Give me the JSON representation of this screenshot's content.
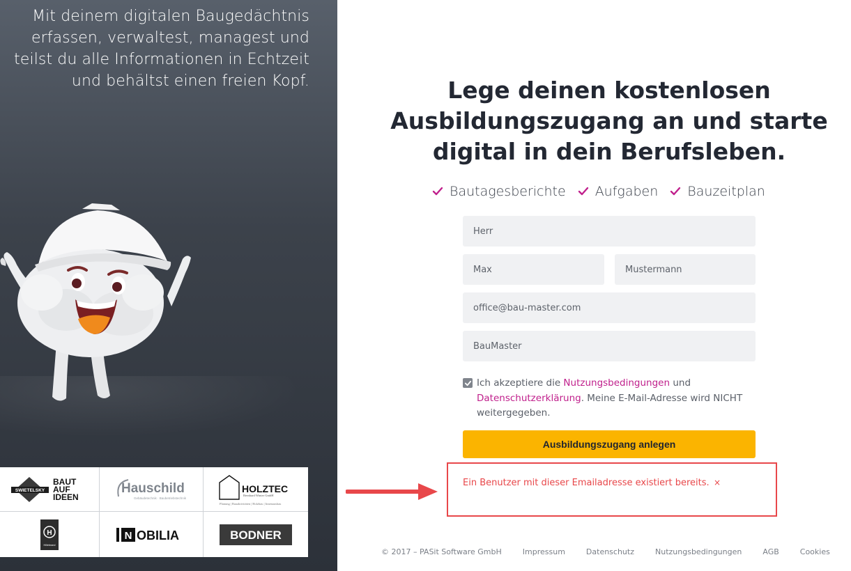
{
  "left": {
    "tagline": "Mit deinem digitalen Baugedächtnis erfassen, verwaltest, managest und teilst du alle Informationen in Echtzeit und behältst einen freien Kopf.",
    "logos": [
      {
        "name": "swietelsky-baut-auf-ideen",
        "text": "SWIETELSKY",
        "sub": "BAUT AUF IDEEN"
      },
      {
        "name": "hauschild",
        "text": "Hauschild",
        "sub": "Gebäudetechnik · Baubetriebstechnik"
      },
      {
        "name": "holztec",
        "text": "HOLZTEC",
        "sub": "Bernhard Winter GmbH"
      },
      {
        "name": "hillebrand",
        "text": "H",
        "sub": "Hillebrand"
      },
      {
        "name": "inmobilia",
        "text": "INMOBILIA"
      },
      {
        "name": "bodner",
        "text": "BODNER"
      }
    ]
  },
  "main": {
    "headline": "Lege deinen kostenlosen Ausbildungszugang an und starte digital in dein Berufsleben.",
    "features": [
      "Bautagesberichte",
      "Aufgaben",
      "Bauzeitplan"
    ],
    "accent_color": "#c0208c",
    "form": {
      "salutation_value": "Herr",
      "first_name_value": "Max",
      "last_name_value": "Mustermann",
      "email_value": "office@bau-master.com",
      "company_value": "BauMaster",
      "consent_checked": true,
      "consent_prefix": "Ich akzeptiere die ",
      "consent_link1": "Nutzungsbedingungen",
      "consent_mid": " und ",
      "consent_link2": "Datenschutzerklärung",
      "consent_suffix": ". Meine E-Mail-Adresse wird NICHT weitergegeben.",
      "submit_label": "Ausbildungszugang anlegen"
    },
    "error": {
      "message": "Ein Benutzer mit dieser Emailadresse existiert bereits.",
      "close": "×",
      "color": "#e8474a"
    }
  },
  "footer": {
    "copyright": "© 2017 – PASit Software GmbH",
    "links": [
      "Impressum",
      "Datenschutz",
      "Nutzungsbedingungen",
      "AGB",
      "Cookies"
    ]
  },
  "colors": {
    "button": "#fbb400",
    "panel_dark": "#3c424b"
  }
}
